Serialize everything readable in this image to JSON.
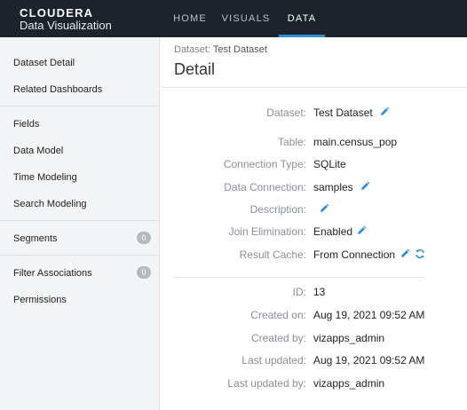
{
  "brand": {
    "name": "CLOUDERA",
    "product": "Data Visualization"
  },
  "nav": {
    "tabs": [
      "HOME",
      "VISUALS",
      "DATA"
    ],
    "active": "DATA"
  },
  "sidebar": {
    "items": [
      {
        "label": "Dataset Detail"
      },
      {
        "label": "Related Dashboards"
      },
      {
        "label": "Fields"
      },
      {
        "label": "Data Model"
      },
      {
        "label": "Time Modeling"
      },
      {
        "label": "Search Modeling"
      },
      {
        "label": "Segments",
        "count": "0"
      },
      {
        "label": "Filter Associations",
        "count": "0"
      },
      {
        "label": "Permissions"
      }
    ]
  },
  "breadcrumb": {
    "label": "Dataset:",
    "value": "Test Dataset"
  },
  "page_title": "Detail",
  "details": {
    "dataset": {
      "label": "Dataset:",
      "value": "Test Dataset"
    },
    "table": {
      "label": "Table:",
      "value": "main.census_pop"
    },
    "connection_type": {
      "label": "Connection Type:",
      "value": "SQLite"
    },
    "data_connection": {
      "label": "Data Connection:",
      "value": "samples"
    },
    "description": {
      "label": "Description:",
      "value": ""
    },
    "join_elimination": {
      "label": "Join Elimination:",
      "value": "Enabled"
    },
    "result_cache": {
      "label": "Result Cache:",
      "value": "From Connection"
    },
    "id": {
      "label": "ID:",
      "value": "13"
    },
    "created_on": {
      "label": "Created on:",
      "value": "Aug 19, 2021 09:52 AM"
    },
    "created_by": {
      "label": "Created by:",
      "value": "vizapps_admin"
    },
    "last_updated": {
      "label": "Last updated:",
      "value": "Aug 19, 2021 09:52 AM"
    },
    "last_updated_by": {
      "label": "Last updated by:",
      "value": "vizapps_admin"
    }
  },
  "icons": {
    "edit": "pencil-icon",
    "refresh": "refresh-icon"
  },
  "colors": {
    "topbar": "#1d232a",
    "accent": "#2f8fd8",
    "sidebar_bg": "#f3f4f5",
    "label": "#8a8f95"
  }
}
